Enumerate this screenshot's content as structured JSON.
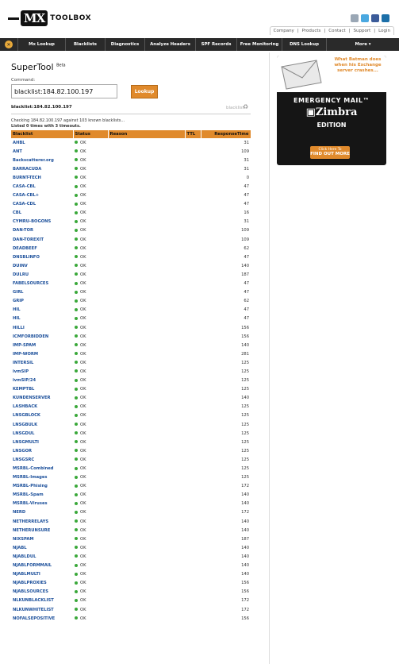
{
  "header": {
    "logo_mx": "MX",
    "logo_text": "TOOLBOX",
    "social_icons": [
      "share-icon",
      "twitter-icon",
      "facebook-icon",
      "linkedin-icon"
    ],
    "util_links": [
      "Company",
      "Products",
      "Contact",
      "Support",
      "Login"
    ]
  },
  "nav": {
    "home_icon": "mx-home-icon",
    "items": [
      "Mx Lookup",
      "Blacklists",
      "Diagnostics",
      "Analyze Headers",
      "SPF Records",
      "Free Monitoring",
      "DNS Lookup",
      "More ▾"
    ]
  },
  "main": {
    "title": "SuperTool",
    "title_sup": "Beta",
    "command_label": "Command:",
    "command_value": "blacklist:184.82.100.197",
    "lookup_label": "Lookup",
    "subhead": "blacklist:184.82.100.197",
    "badge": "blacklist",
    "check_line1": "Checking 184.82.100.197 against 103 known blacklists...",
    "check_line2": "Listed 0 times with 3 timeouts.",
    "columns": [
      "Blacklist",
      "Status",
      "Reason",
      "TTL",
      "ResponseTime"
    ]
  },
  "rows": [
    [
      "AHBL",
      "OK",
      "31"
    ],
    [
      "ANT",
      "OK",
      "109"
    ],
    [
      "Backscatterer.org",
      "OK",
      "31"
    ],
    [
      "BARRACUDA",
      "OK",
      "31"
    ],
    [
      "BURNT-TECH",
      "OK",
      "0"
    ],
    [
      "CASA-CBL",
      "OK",
      "47"
    ],
    [
      "CASA-CBL+",
      "OK",
      "47"
    ],
    [
      "CASA-CDL",
      "OK",
      "47"
    ],
    [
      "CBL",
      "OK",
      "16"
    ],
    [
      "CYMRU-BOGONS",
      "OK",
      "31"
    ],
    [
      "DAN-TOR",
      "OK",
      "109"
    ],
    [
      "DAN-TOREXIT",
      "OK",
      "109"
    ],
    [
      "DEADBEEF",
      "OK",
      "62"
    ],
    [
      "DNSBLINFO",
      "OK",
      "47"
    ],
    [
      "DUINV",
      "OK",
      "140"
    ],
    [
      "DULRU",
      "OK",
      "187"
    ],
    [
      "FABELSOURCES",
      "OK",
      "47"
    ],
    [
      "GIRL",
      "OK",
      "47"
    ],
    [
      "GRIP",
      "OK",
      "62"
    ],
    [
      "HIL",
      "OK",
      "47"
    ],
    [
      "HIL",
      "OK",
      "47"
    ],
    [
      "HILLI",
      "OK",
      "156"
    ],
    [
      "ICMFORBIDDEN",
      "OK",
      "156"
    ],
    [
      "IMP-SPAM",
      "OK",
      "140"
    ],
    [
      "IMP-WORM",
      "OK",
      "281"
    ],
    [
      "INTERSIL",
      "OK",
      "125"
    ],
    [
      "ivmSIP",
      "OK",
      "125"
    ],
    [
      "ivmSIP/24",
      "OK",
      "125"
    ],
    [
      "KEMPTBL",
      "OK",
      "125"
    ],
    [
      "KUNDENSERVER",
      "OK",
      "140"
    ],
    [
      "LASHBACK",
      "OK",
      "125"
    ],
    [
      "LNSGBLOCK",
      "OK",
      "125"
    ],
    [
      "LNSGBULK",
      "OK",
      "125"
    ],
    [
      "LNSGDUL",
      "OK",
      "125"
    ],
    [
      "LNSGMULTI",
      "OK",
      "125"
    ],
    [
      "LNSGOR",
      "OK",
      "125"
    ],
    [
      "LNSGSRC",
      "OK",
      "125"
    ],
    [
      "MSRBL-Combined",
      "OK",
      "125"
    ],
    [
      "MSRBL-Images",
      "OK",
      "125"
    ],
    [
      "MSRBL-Phising",
      "OK",
      "172"
    ],
    [
      "MSRBL-Spam",
      "OK",
      "140"
    ],
    [
      "MSRBL-Viruses",
      "OK",
      "140"
    ],
    [
      "NERD",
      "OK",
      "172"
    ],
    [
      "NETHERRELAYS",
      "OK",
      "140"
    ],
    [
      "NETHERUNSURE",
      "OK",
      "140"
    ],
    [
      "NIXSPAM",
      "OK",
      "187"
    ],
    [
      "NJABL",
      "OK",
      "140"
    ],
    [
      "NJABLDUL",
      "OK",
      "140"
    ],
    [
      "NJABLFORMMAIL",
      "OK",
      "140"
    ],
    [
      "NJABLMULTI",
      "OK",
      "140"
    ],
    [
      "NJABLPROXIES",
      "OK",
      "156"
    ],
    [
      "NJABLSOURCES",
      "OK",
      "156"
    ],
    [
      "NLKUNBLACKLIST",
      "OK",
      "172"
    ],
    [
      "NLKUNWHITELIST",
      "OK",
      "172"
    ],
    [
      "NOFALSEPOSITIVE",
      "OK",
      "156"
    ]
  ],
  "ad": {
    "quote": "What Batman does when his Exchange server crashes...",
    "emergency": "EMERGENCY MAIL™",
    "brand": "Zimbra",
    "edition": "EDITION",
    "btn_small": "Click Here To",
    "btn_big": "FIND OUT MORE"
  }
}
